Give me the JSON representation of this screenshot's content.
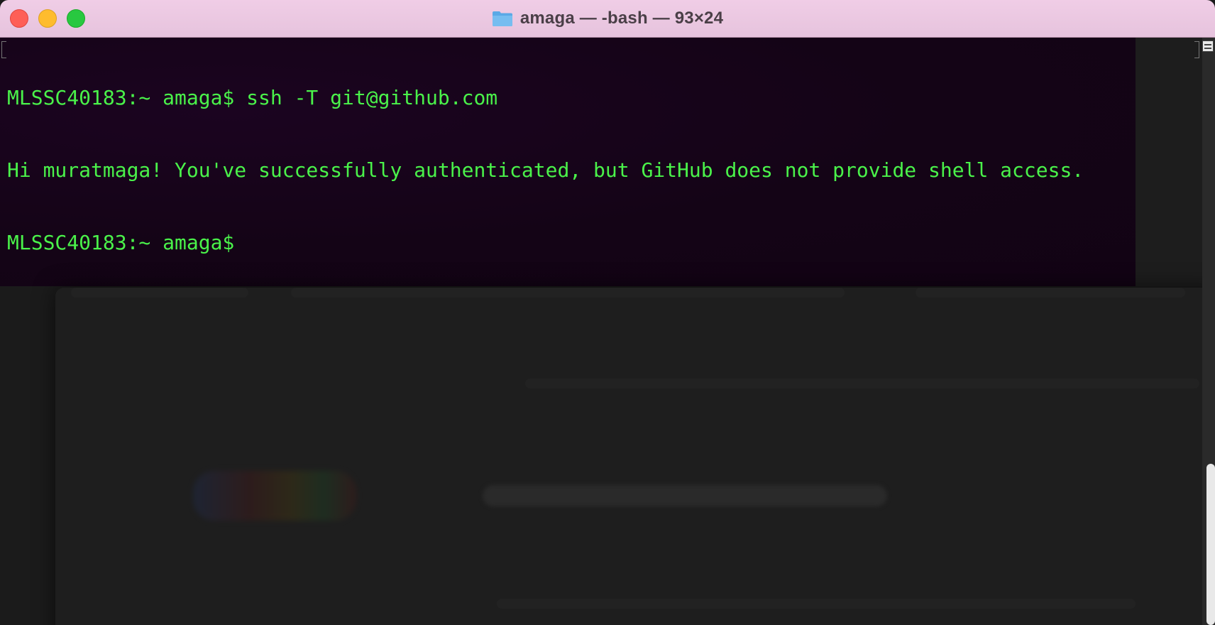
{
  "window": {
    "title": "amaga — -bash — 93×24",
    "folder_icon": "folder-icon",
    "buttons": {
      "close": "close-button",
      "minimize": "minimize-button",
      "zoom": "zoom-button"
    }
  },
  "terminal": {
    "lines": [
      "MLSSC40183:~ amaga$ ssh -T git@github.com",
      "Hi muratmaga! You've successfully authenticated, but GitHub does not provide shell access.",
      "MLSSC40183:~ amaga$"
    ],
    "text_color": "#4af24a",
    "background_color": "#120314"
  },
  "colors": {
    "titlebar": "#ecc8e2",
    "close": "#fe5f57",
    "minimize": "#febc2e",
    "zoom": "#28c840"
  }
}
